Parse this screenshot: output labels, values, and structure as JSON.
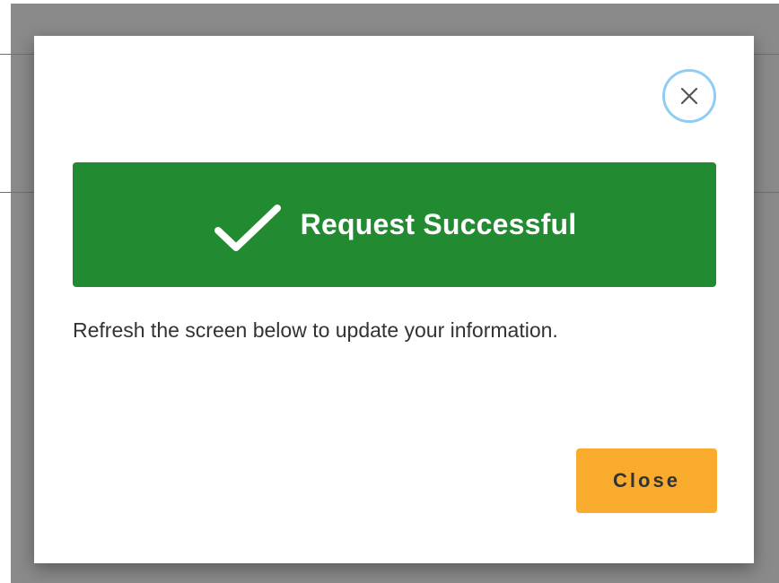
{
  "modal": {
    "banner": {
      "title": "Request Successful",
      "icon": "check-icon",
      "color": "#228a30"
    },
    "message": "Refresh the screen below to update your information.",
    "close_icon": "close-icon",
    "close_button_label": "Close",
    "close_button_color": "#f9ab2d"
  }
}
